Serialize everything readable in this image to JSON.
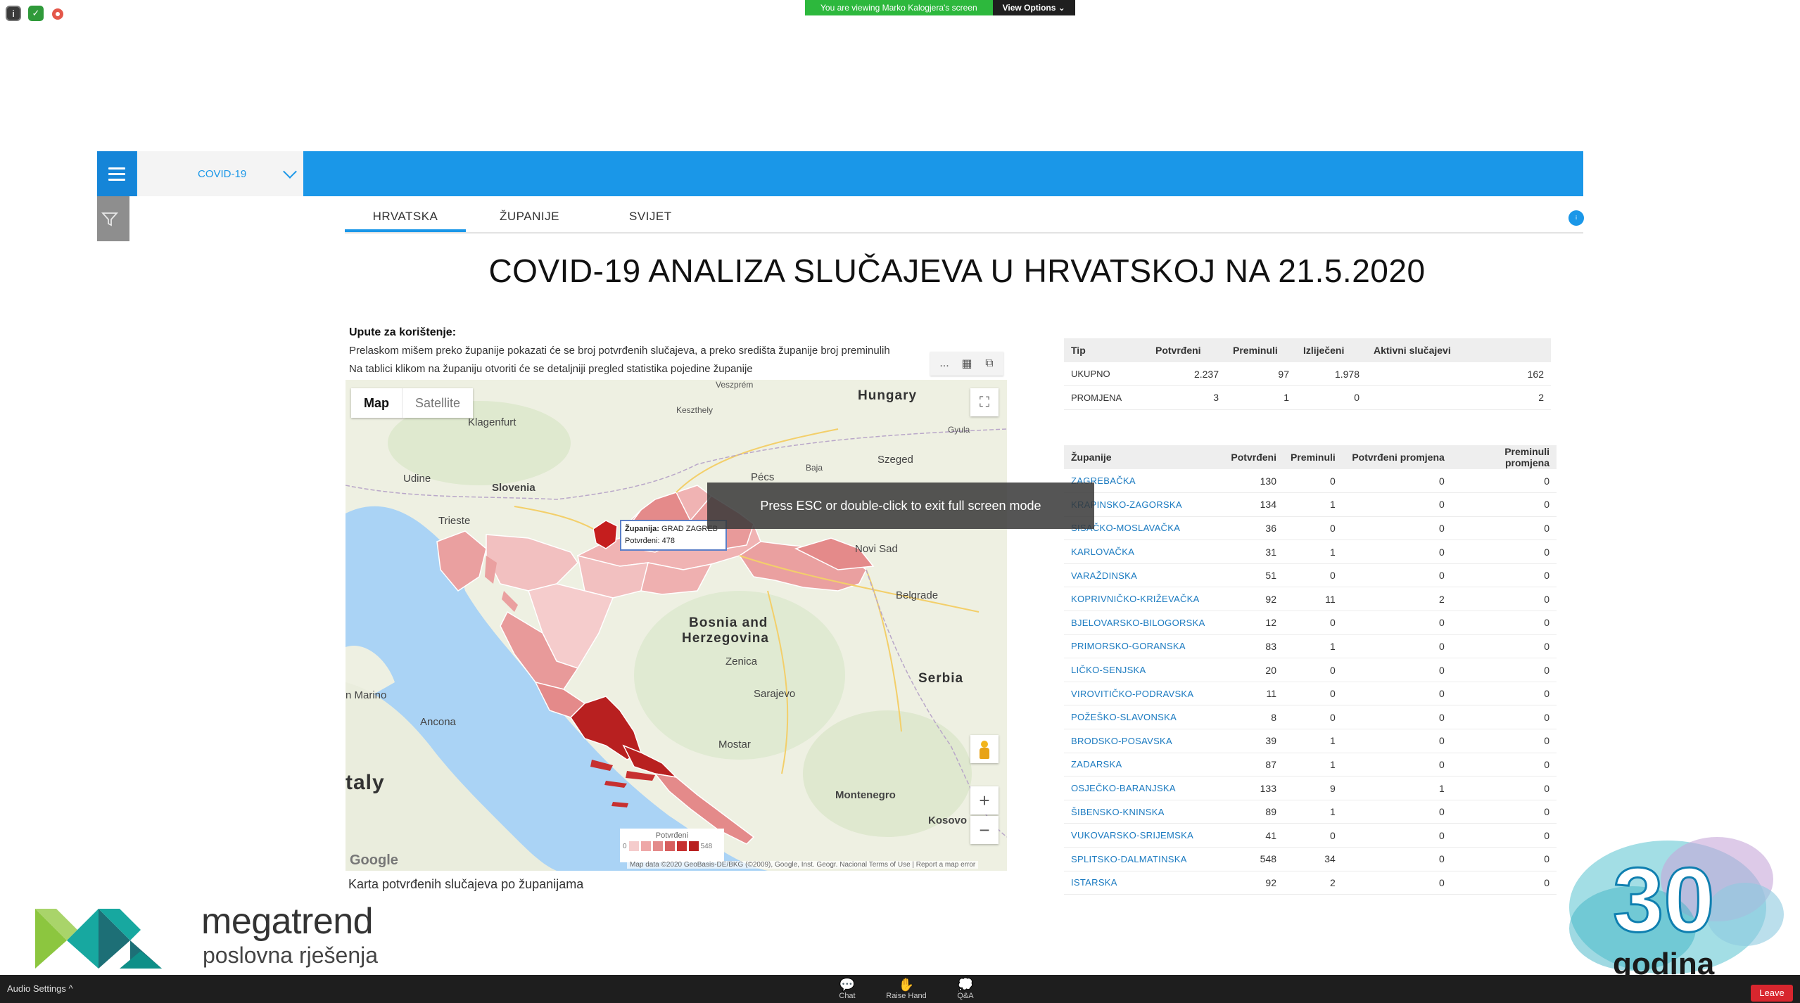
{
  "zoom": {
    "viewing_message": "You are viewing Marko Kalogjera's screen",
    "view_options": "View Options ⌄",
    "fullscreen_hint": "Press ESC or double-click to exit full screen mode",
    "audio_settings": "Audio Settings ^",
    "chat": "Chat",
    "raise_hand": "Raise Hand",
    "qa": "Q&A",
    "leave": "Leave"
  },
  "dashboard": {
    "dropdown_value": "COVID-19",
    "tabs": [
      "HRVATSKA",
      "ŽUPANIJE",
      "SVIJET"
    ],
    "active_tab": 0,
    "title": "COVID-19 ANALIZA SLUČAJEVA U HRVATSKOJ NA 21.5.2020",
    "instructions": {
      "heading": "Upute za korištenje:",
      "line1": "Prelaskom mišem preko županije pokazati će se broj potvrđenih slučajeva, a preko središta županije broj preminulih",
      "line2": "Na tablici klikom na županiju otvoriti će se detaljniji pregled statistika pojedine županije"
    }
  },
  "map": {
    "map_type_map": "Map",
    "map_type_satellite": "Satellite",
    "labels": {
      "hungary": "Hungary",
      "slovenia": "Slovenia",
      "bosnia1": "Bosnia and",
      "bosnia2": "Herzegovina",
      "serbia": "Serbia",
      "italy": "taly",
      "montenegro": "Montenegro",
      "kosovo": "Kosovo",
      "szeged": "Szeged",
      "pecs": "Pécs",
      "belgrade": "Belgrade",
      "novi_sad": "Novi Sad",
      "sarajevo": "Sarajevo",
      "mostar": "Mostar",
      "trieste": "Trieste",
      "udine": "Udine",
      "klagenfurt": "Klagenfurt",
      "ancona": "Ancona",
      "san_marino": "n Marino",
      "zenica": "Zenica",
      "keszthely": "Keszthely",
      "veszprem": "Veszprém",
      "baja": "Baja",
      "gyula": "Gyula"
    },
    "tooltip_label_zupanija": "Županija:",
    "tooltip_value_zupanija": "GRAD ZAGREB",
    "tooltip_label_potvrdeni": "Potvrđeni:",
    "tooltip_value_potvrdeni": "478",
    "legend_title": "Potvrđeni",
    "legend_min": "0",
    "legend_max": "548",
    "google": "Google",
    "attribution": "Map data ©2020 GeoBasis-DE/BKG (©2009), Google, Inst. Geogr. Nacional   Terms of Use | Report a map error",
    "zoom_in": "+",
    "zoom_out": "−",
    "caption": "Karta potvrđenih slučajeva po županijama",
    "tool_more": "...",
    "colors": {
      "water": "#aad3f5",
      "land": "#eef0e2",
      "croatia_light": "#f0b3b3",
      "croatia_mid": "#e48a8a",
      "croatia_dark": "#b82020",
      "zagreb": "#c51e1e"
    }
  },
  "summary_table": {
    "headers": [
      "Tip",
      "Potvrđeni",
      "Preminuli",
      "Izliječeni",
      "Aktivni slučajevi"
    ],
    "rows": [
      [
        "UKUPNO",
        "2.237",
        "97",
        "1.978",
        "162"
      ],
      [
        "PROMJENA",
        "3",
        "1",
        "0",
        "2"
      ]
    ]
  },
  "county_table": {
    "headers": [
      "Županije",
      "Potvrđeni",
      "Preminuli",
      "Potvrđeni promjena",
      "Preminuli promjena"
    ],
    "rows": [
      [
        "ZAGREBAČKA",
        "130",
        "0",
        "0",
        "0"
      ],
      [
        "KRAPINSKO-ZAGORSKA",
        "134",
        "1",
        "0",
        "0"
      ],
      [
        "SISAČKO-MOSLAVAČKA",
        "36",
        "0",
        "0",
        "0"
      ],
      [
        "KARLOVAČKA",
        "31",
        "1",
        "0",
        "0"
      ],
      [
        "VARAŽDINSKA",
        "51",
        "0",
        "0",
        "0"
      ],
      [
        "KOPRIVNIČKO-KRIŽEVAČKA",
        "92",
        "11",
        "2",
        "0"
      ],
      [
        "BJELOVARSKO-BILOGORSKA",
        "12",
        "0",
        "0",
        "0"
      ],
      [
        "PRIMORSKO-GORANSKA",
        "83",
        "1",
        "0",
        "0"
      ],
      [
        "LIČKO-SENJSKA",
        "20",
        "0",
        "0",
        "0"
      ],
      [
        "VIROVITIČKO-PODRAVSKA",
        "11",
        "0",
        "0",
        "0"
      ],
      [
        "POŽEŠKO-SLAVONSKA",
        "8",
        "0",
        "0",
        "0"
      ],
      [
        "BRODSKO-POSAVSKA",
        "39",
        "1",
        "0",
        "0"
      ],
      [
        "ZADARSKA",
        "87",
        "1",
        "0",
        "0"
      ],
      [
        "OSJEČKO-BARANJSKA",
        "133",
        "9",
        "1",
        "0"
      ],
      [
        "ŠIBENSKO-KNINSKA",
        "89",
        "1",
        "0",
        "0"
      ],
      [
        "VUKOVARSKO-SRIJEMSKA",
        "41",
        "0",
        "0",
        "0"
      ],
      [
        "SPLITSKO-DALMATINSKA",
        "548",
        "34",
        "0",
        "0"
      ],
      [
        "ISTARSKA",
        "92",
        "2",
        "0",
        "0"
      ]
    ]
  },
  "branding": {
    "company": "megatrend",
    "subtitle": "poslovna rješenja",
    "anniversary_number": "30",
    "anniversary_word": "godina",
    "colors": {
      "logo_green": "#8cc63f",
      "logo_teal": "#17a8a0",
      "logo_dark": "#1d6f76",
      "anniv_blue": "#0f7fb0"
    }
  }
}
